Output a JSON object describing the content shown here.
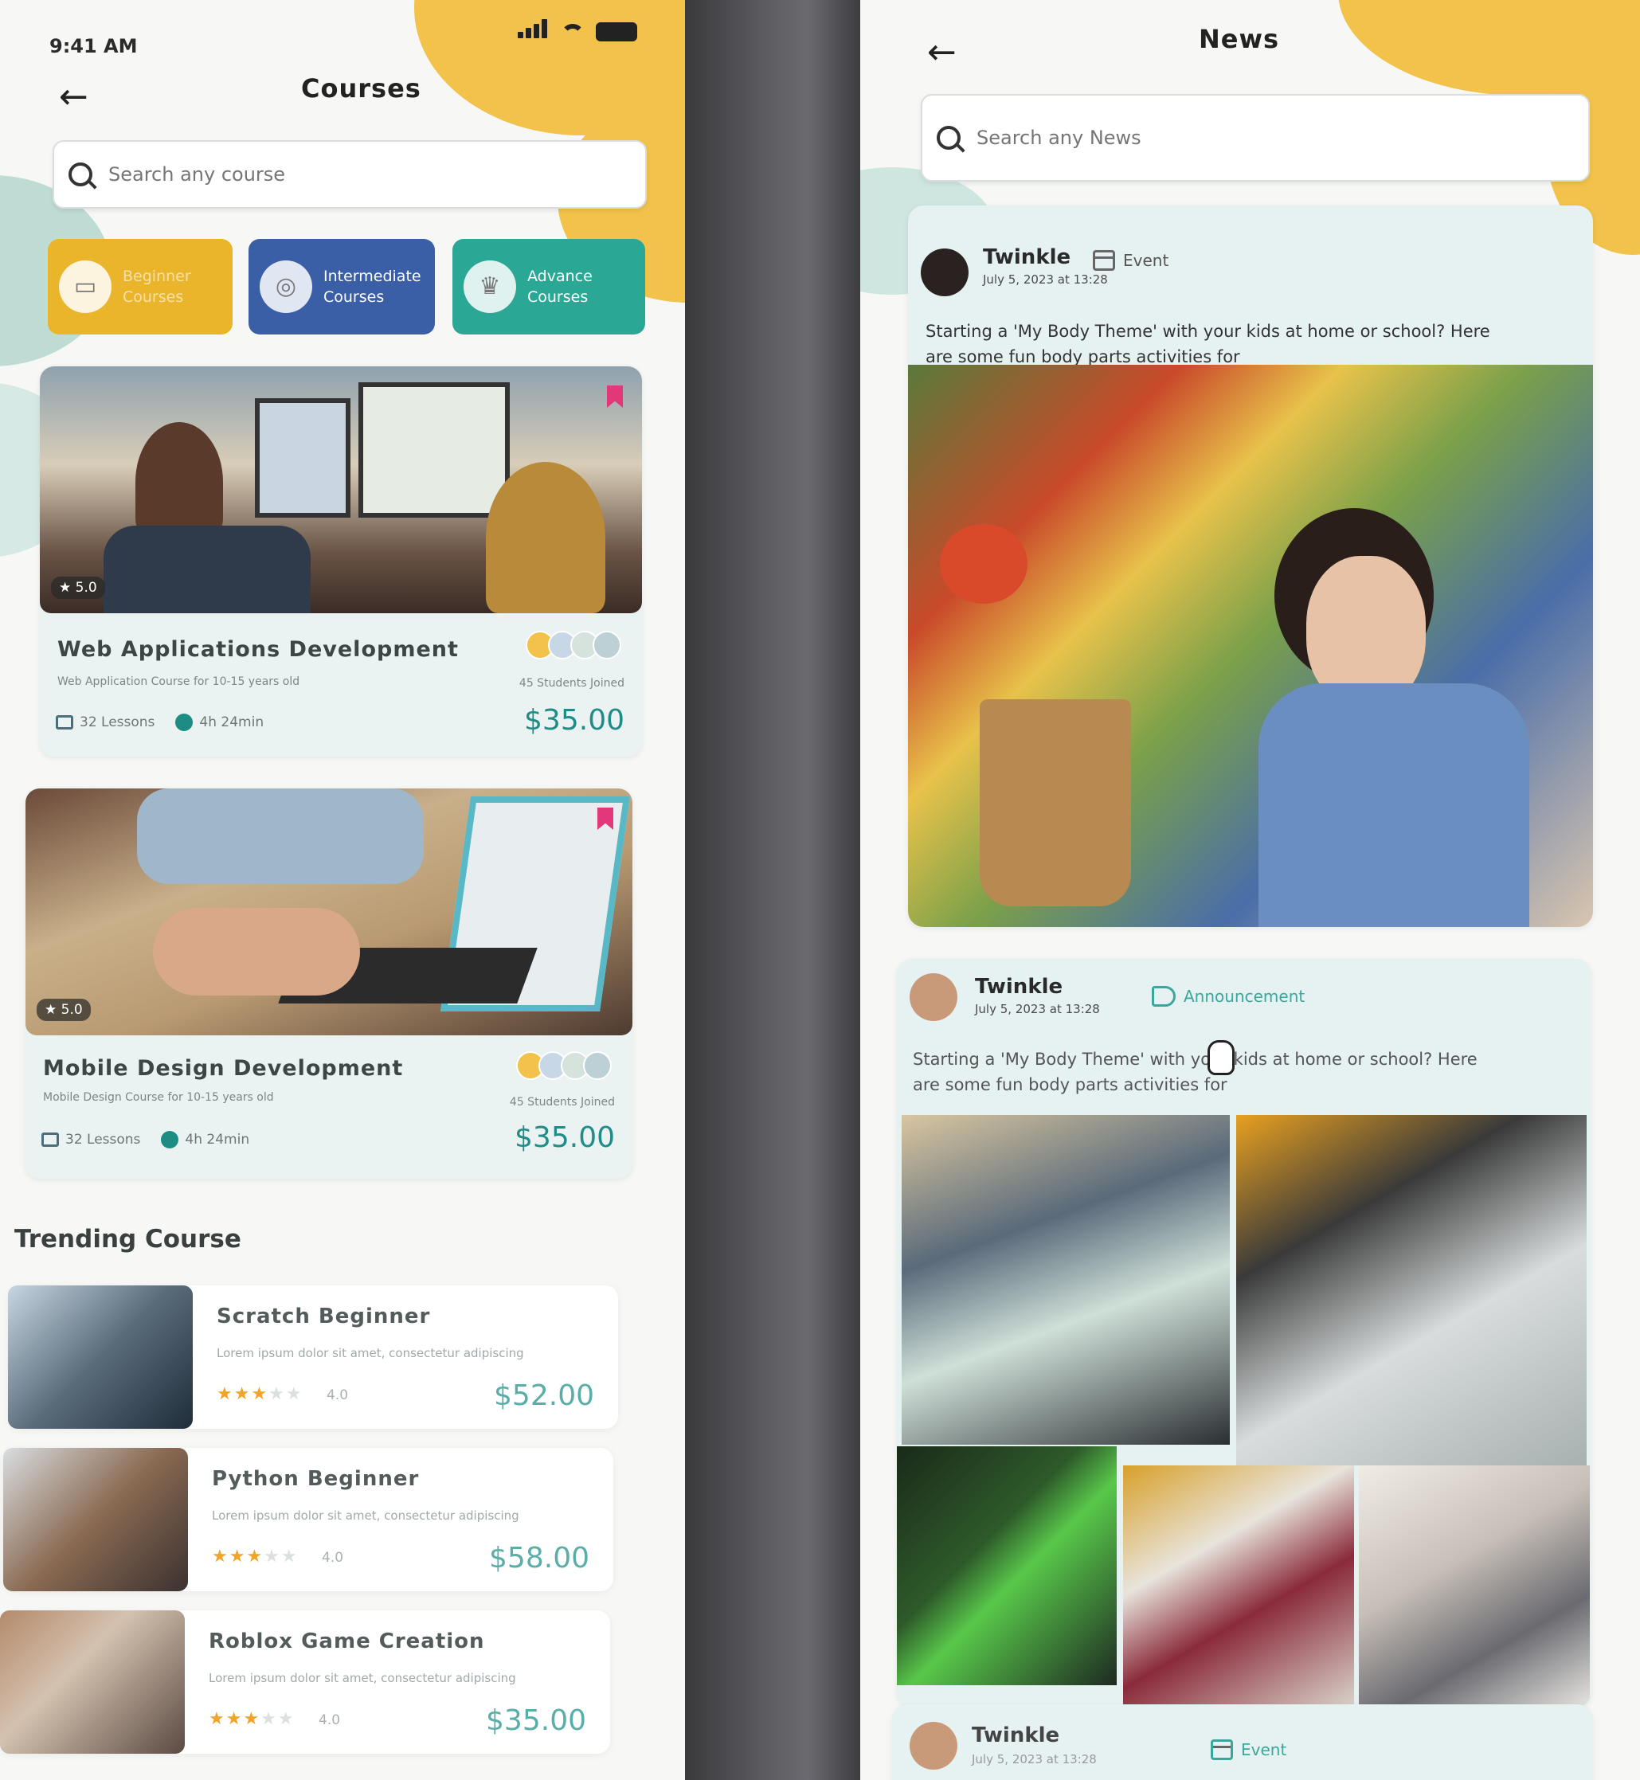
{
  "left": {
    "status_time": "9:41 AM",
    "title": "Courses",
    "search_placeholder": "Search any course",
    "categories": [
      {
        "label_line1": "Beginner",
        "label_line2": "Courses"
      },
      {
        "label_line1": "Intermediate",
        "label_line2": "Courses"
      },
      {
        "label_line1": "Advance",
        "label_line2": "Courses"
      }
    ],
    "courses": [
      {
        "title": "Web Applications Development",
        "subtitle": "Web Application Course for 10-15 years old",
        "rating": "★ 5.0",
        "lessons": "32 Lessons",
        "duration": "4h 24min",
        "students": "45 Students Joined",
        "price": "$35.00"
      },
      {
        "title": "Mobile Design Development",
        "subtitle": "Mobile Design Course for 10-15 years old",
        "rating": "★ 5.0",
        "lessons": "32 Lessons",
        "duration": "4h 24min",
        "students": "45 Students Joined",
        "price": "$35.00"
      }
    ],
    "section_title": "Trending Course",
    "trending": [
      {
        "title": "Scratch Beginner",
        "desc": "Lorem ipsum dolor sit amet, consectetur adipiscing",
        "stars": 3,
        "rating": "4.0",
        "price": "$52.00"
      },
      {
        "title": "Python Beginner",
        "desc": "Lorem ipsum dolor sit amet, consectetur adipiscing",
        "stars": 3,
        "rating": "4.0",
        "price": "$58.00"
      },
      {
        "title": "Roblox Game Creation",
        "desc": "Lorem ipsum dolor sit amet, consectetur adipiscing",
        "stars": 3,
        "rating": "4.0",
        "price": "$35.00"
      }
    ]
  },
  "right": {
    "title": "News",
    "search_placeholder": "Search any News",
    "posts": [
      {
        "author": "Twinkle",
        "date": "July 5, 2023 at 13:28",
        "tag": "Event",
        "text_line1": "Starting a 'My Body Theme' with your kids at home or school? Here",
        "text_line2": "are some fun body parts activities for"
      },
      {
        "author": "Twinkle",
        "date": "July 5, 2023 at 13:28",
        "tag": "Announcement",
        "text_line1": "Starting a 'My Body Theme' with your kids at home or school? Here",
        "text_line2": "are some fun body parts activities for"
      },
      {
        "author": "Twinkle",
        "date": "July 5, 2023 at 13:28",
        "tag": "Event"
      }
    ]
  },
  "colors": {
    "yellow": "#eab52a",
    "blue": "#3a5fa6",
    "teal": "#2aa795",
    "price": "#1f8c87",
    "bookmark": "#e23779"
  },
  "icons": [
    "back-arrow-icon",
    "search-icon",
    "book-icon",
    "medal-icon",
    "trophy-icon",
    "bookmark-icon",
    "lesson-icon",
    "clock-icon",
    "star-icon",
    "calendar-icon",
    "megaphone-icon",
    "hand-cursor-icon"
  ]
}
